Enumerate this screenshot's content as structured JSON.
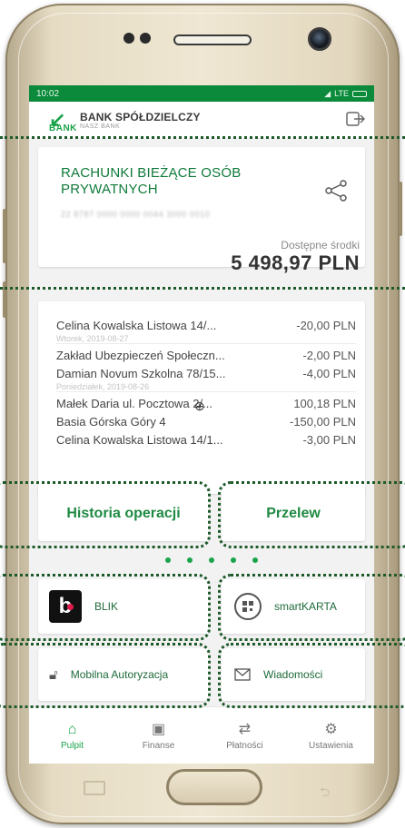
{
  "status_bar": {
    "time": "10:02",
    "network": "LTE"
  },
  "header": {
    "bank_name": "BANK SPÓŁDZIELCZY",
    "bank_tagline": "NASZ BANK",
    "logo_word": "BANK"
  },
  "account": {
    "title": "RACHUNKI BIEŻĄCE OSÓB PRYWATNYCH",
    "number_masked": "22 8787 0000 0000 0044 3000 0010",
    "available_label": "Dostępne środki",
    "available_amount": "5 498,97 PLN"
  },
  "transactions": [
    {
      "name": "Celina Kowalska Listowa 14/...",
      "amount": "-20,00 PLN"
    },
    {
      "date": "Wtorek, 2019-08-27"
    },
    {
      "name": "Zakład Ubezpieczeń Społeczn...",
      "amount": "-2,00 PLN"
    },
    {
      "name": "Damian Novum Szkolna 78/15...",
      "amount": "-4,00 PLN"
    },
    {
      "date": "Poniedziałek, 2019-08-26"
    },
    {
      "name": "Małek Daria  ul. Pocztowa 2/...",
      "amount": "100,18 PLN"
    },
    {
      "name": "Basia Górska Góry 4",
      "amount": "-150,00 PLN"
    },
    {
      "name": "Celina Kowalska Listowa 14/1...",
      "amount": "-3,00 PLN"
    }
  ],
  "actions": {
    "history": "Historia operacji",
    "transfer": "Przelew",
    "blik": "BLIK",
    "blik_logo_letter": "b",
    "smartkarta": "smartKARTA",
    "mobile_auth": "Mobilna Autoryzacja",
    "messages": "Wiadomości"
  },
  "bottom_nav": [
    {
      "label": "Pulpit",
      "icon": "home-icon",
      "active": true
    },
    {
      "label": "Finanse",
      "icon": "wallet-icon",
      "active": false
    },
    {
      "label": "Płatności",
      "icon": "transfer-arrows-icon",
      "active": false
    },
    {
      "label": "Ustawienia",
      "icon": "gear-icon",
      "active": false
    }
  ],
  "colors": {
    "brand_green": "#1aa34a",
    "status_green": "#0a8a3a",
    "blik_red": "#e21b4d"
  }
}
